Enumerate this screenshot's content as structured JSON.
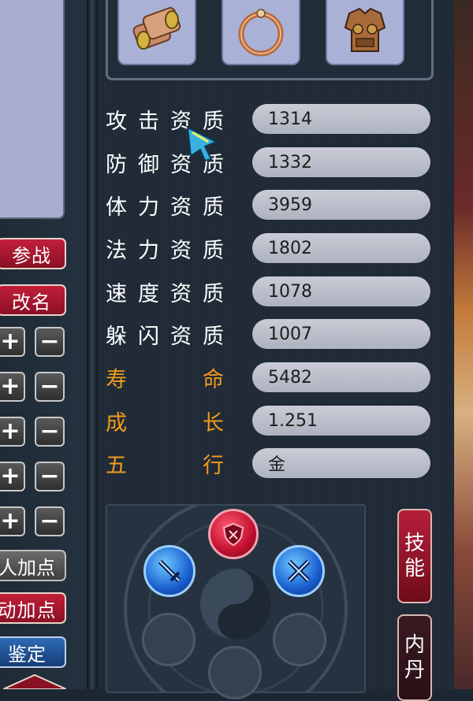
{
  "left_panel": {
    "buttons": {
      "join_battle": "参战",
      "rename": "改名",
      "manual_add_points": "人加点",
      "auto_add_points": "动加点",
      "appraise": "鉴定"
    },
    "plus_label": "+",
    "minus_label": "−"
  },
  "equipment": [
    {
      "name": "scroll-bracer"
    },
    {
      "name": "ring"
    },
    {
      "name": "armor"
    }
  ],
  "attributes": [
    {
      "label": [
        "攻",
        "击",
        "资",
        "质"
      ],
      "value": "1314",
      "highlight": false
    },
    {
      "label": [
        "防",
        "御",
        "资",
        "质"
      ],
      "value": "1332",
      "highlight": false
    },
    {
      "label": [
        "体",
        "力",
        "资",
        "质"
      ],
      "value": "3959",
      "highlight": false
    },
    {
      "label": [
        "法",
        "力",
        "资",
        "质"
      ],
      "value": "1802",
      "highlight": false
    },
    {
      "label": [
        "速",
        "度",
        "资",
        "质"
      ],
      "value": "1078",
      "highlight": false
    },
    {
      "label": [
        "躲",
        "闪",
        "资",
        "质"
      ],
      "value": "1007",
      "highlight": false
    },
    {
      "label": [
        "寿",
        "命"
      ],
      "value": "5482",
      "highlight": true
    },
    {
      "label": [
        "成",
        "长"
      ],
      "value": "1.251",
      "highlight": true
    },
    {
      "label": [
        "五",
        "行"
      ],
      "value": "金",
      "highlight": true
    }
  ],
  "side_tabs": {
    "skills": [
      "技",
      "能"
    ],
    "inner_dan": [
      "内",
      "丹"
    ]
  },
  "colors": {
    "label_white": "#ffffff",
    "label_orange": "#f19a1e",
    "value_bg": "#c0c3ce",
    "red_button": "#b01c36",
    "blue_button": "#2a5fa3"
  }
}
